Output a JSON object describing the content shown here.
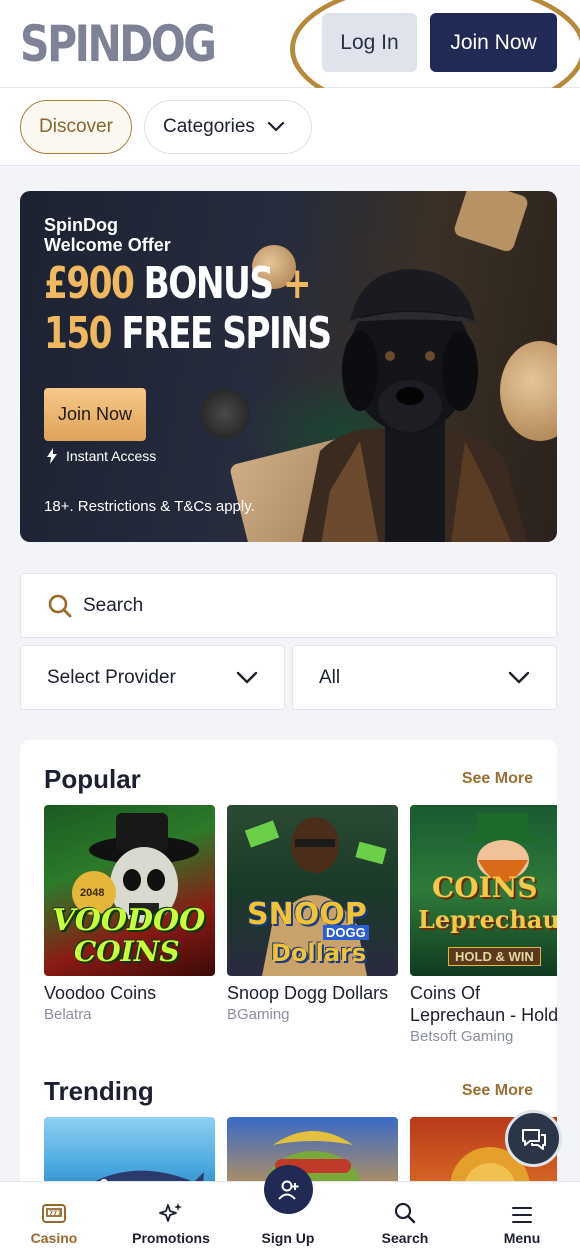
{
  "header": {
    "logo": "SPINDOG",
    "login_label": "Log In",
    "join_label": "Join Now"
  },
  "nav": {
    "discover_label": "Discover",
    "categories_label": "Categories"
  },
  "banner": {
    "subtitle_line1": "SpinDog",
    "subtitle_line2": "Welcome Offer",
    "amount": "£900",
    "bonus_word": "BONUS",
    "plus": "+",
    "spins_count": "150",
    "spins_word": "FREE SPINS",
    "cta_label": "Join Now",
    "instant_label": "Instant Access",
    "terms": "18+. Restrictions & T&Cs apply."
  },
  "search": {
    "placeholder": "Search"
  },
  "filters": {
    "provider_label": "Select Provider",
    "type_label": "All"
  },
  "popular": {
    "title": "Popular",
    "see_more": "See More",
    "games": [
      {
        "name": "Voodoo Coins",
        "provider": "Belatra",
        "art_text_1": "VOODOO",
        "art_text_2": "COINS",
        "art_badge": "2048"
      },
      {
        "name": "Snoop Dogg Dollars",
        "provider": "BGaming",
        "art_text_1": "SNOOP",
        "art_text_2": "Dollars",
        "art_badge": "DOGG"
      },
      {
        "name_line1": "Coins Of",
        "name_line2": "Leprechaun - Hold",
        "provider": "Betsoft Gaming",
        "art_text_1": "COINS",
        "art_text_2": "Leprechaun",
        "art_badge": "HOLD & WIN"
      }
    ]
  },
  "trending": {
    "title": "Trending",
    "see_more": "See More"
  },
  "bottom_nav": {
    "items": [
      {
        "label": "Casino",
        "icon": "slot-machine-icon"
      },
      {
        "label": "Promotions",
        "icon": "sparkles-icon"
      },
      {
        "label": "Sign Up",
        "icon": "add-user-icon"
      },
      {
        "label": "Search",
        "icon": "search-icon"
      },
      {
        "label": "Menu",
        "icon": "hamburger-icon"
      }
    ]
  },
  "colors": {
    "accent_gold": "#9a7133",
    "brand_navy": "#212a55",
    "annotation_ring": "#b58a3a"
  }
}
